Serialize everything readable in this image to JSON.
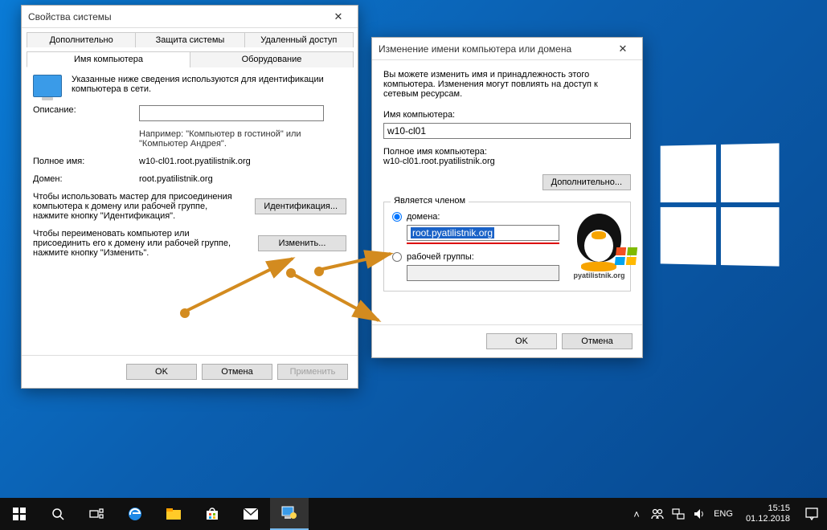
{
  "dialog1": {
    "title": "Свойства системы",
    "tabs_row1": [
      "Дополнительно",
      "Защита системы",
      "Удаленный доступ"
    ],
    "tabs_row2": [
      "Имя компьютера",
      "Оборудование"
    ],
    "intro": "Указанные ниже сведения используются для идентификации компьютера в сети.",
    "desc_label": "Описание:",
    "desc_value": "",
    "desc_hint": "Например: \"Компьютер в гостиной\" или \"Компьютер Андрея\".",
    "fullname_label": "Полное имя:",
    "fullname_value": "w10-cl01.root.pyatilistnik.org",
    "domain_label": "Домен:",
    "domain_value": "root.pyatilistnik.org",
    "wizard_text": "Чтобы использовать мастер для присоединения компьютера к домену или рабочей группе, нажмите кнопку \"Идентификация\".",
    "ident_btn": "Идентификация...",
    "rename_text": "Чтобы переименовать компьютер или присоединить его к домену или рабочей группе, нажмите кнопку \"Изменить\".",
    "change_btn": "Изменить...",
    "ok": "OK",
    "cancel": "Отмена",
    "apply": "Применить"
  },
  "dialog2": {
    "title": "Изменение имени компьютера или домена",
    "intro": "Вы можете изменить имя и принадлежность этого компьютера. Изменения могут повлиять на доступ к сетевым ресурсам.",
    "name_label": "Имя компьютера:",
    "name_value": "w10-cl01",
    "fullname_label": "Полное имя компьютера:",
    "fullname_value": "w10-cl01.root.pyatilistnik.org",
    "more_btn": "Дополнительно...",
    "member_legend": "Является членом",
    "radio_domain": "домена:",
    "domain_value": "root.pyatilistnik.org",
    "radio_workgroup": "рабочей группы:",
    "workgroup_value": "",
    "logo_tag": "pyatilistnik.org",
    "ok": "OK",
    "cancel": "Отмена"
  },
  "taskbar": {
    "lang": "ENG",
    "time": "15:15",
    "date": "01.12.2018"
  }
}
